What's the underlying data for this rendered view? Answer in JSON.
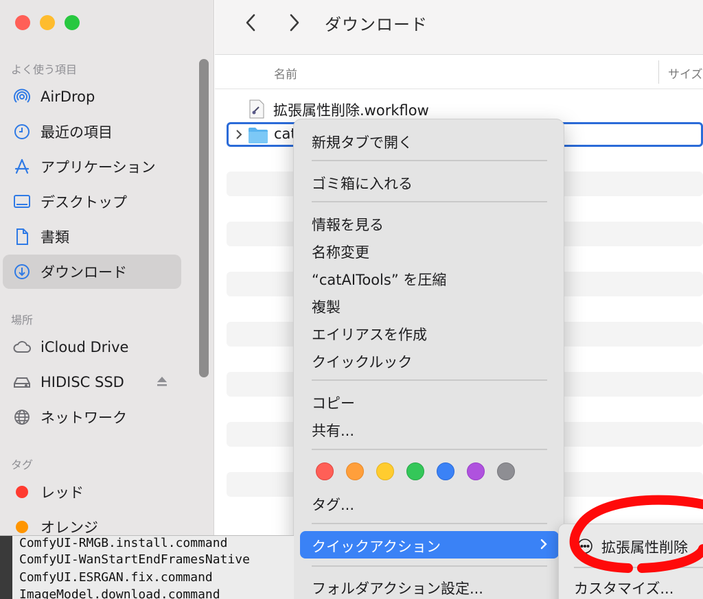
{
  "window": {
    "title": "ダウンロード"
  },
  "sidebar": {
    "favorites_label": "よく使う項目",
    "locations_label": "場所",
    "tags_label": "タグ",
    "favorites": [
      {
        "label": "AirDrop",
        "icon": "airdrop-icon"
      },
      {
        "label": "最近の項目",
        "icon": "clock-icon"
      },
      {
        "label": "アプリケーション",
        "icon": "applications-icon"
      },
      {
        "label": "デスクトップ",
        "icon": "desktop-icon"
      },
      {
        "label": "書類",
        "icon": "document-icon"
      },
      {
        "label": "ダウンロード",
        "icon": "download-icon",
        "selected": true
      }
    ],
    "locations": [
      {
        "label": "iCloud Drive",
        "icon": "cloud-icon"
      },
      {
        "label": "HIDISC SSD",
        "icon": "drive-icon"
      },
      {
        "label": "ネットワーク",
        "icon": "globe-icon"
      }
    ],
    "tags": [
      {
        "label": "レッド",
        "color": "#ff3b30"
      },
      {
        "label": "オレンジ",
        "color": "#ff9500"
      }
    ]
  },
  "list": {
    "col_name": "名前",
    "col_size": "サイズ",
    "files": [
      {
        "name": "拡張属性削除.workflow",
        "icon": "workflow-icon"
      },
      {
        "name": "cat",
        "icon": "folder-icon",
        "selected": true
      }
    ]
  },
  "context_menu": {
    "open_new_tab": "新規タブで開く",
    "move_to_trash": "ゴミ箱に入れる",
    "get_info": "情報を見る",
    "rename": "名称変更",
    "compress": "“catAITools” を圧縮",
    "duplicate": "複製",
    "make_alias": "エイリアスを作成",
    "quick_look": "クイックルック",
    "copy": "コピー",
    "share": "共有...",
    "tag_colors": [
      "#ff5f57",
      "#ff9f3b",
      "#ffcc2f",
      "#34c759",
      "#3b82f6",
      "#af52de",
      "#8e8e93"
    ],
    "tags": "タグ...",
    "quick_actions": "クイックアクション",
    "folder_actions": "フォルダアクション設定..."
  },
  "submenu": {
    "item1": "拡張属性削除",
    "customize": "カスタマイズ..."
  },
  "terminal": {
    "lines": [
      "ComfyUI-RMGB.install.command",
      "ComfyUI-WanStartEndFramesNative",
      "ComfyUI.ESRGAN.fix.command",
      "ImageModel.download.command"
    ]
  }
}
